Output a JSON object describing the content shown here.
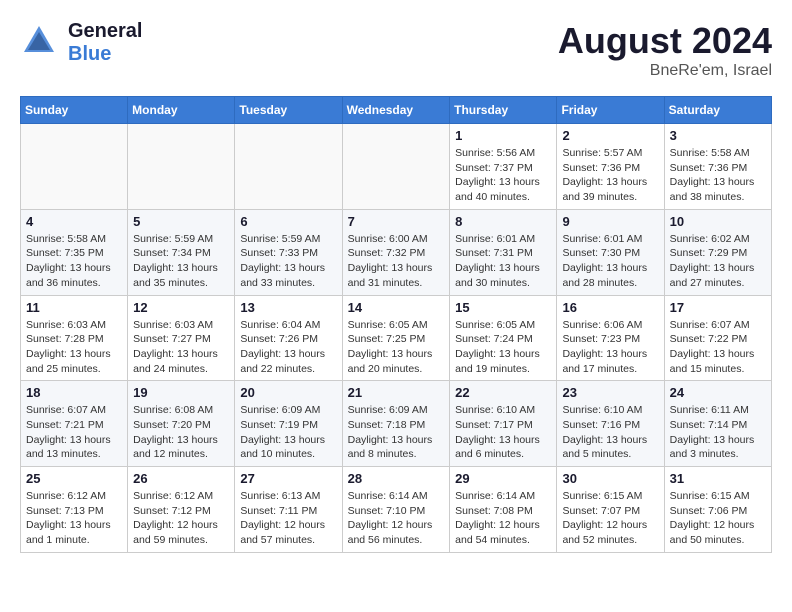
{
  "header": {
    "logo": {
      "general": "General",
      "blue": "Blue"
    },
    "month_year": "August 2024",
    "location": "BneRe'em, Israel"
  },
  "weekdays": [
    "Sunday",
    "Monday",
    "Tuesday",
    "Wednesday",
    "Thursday",
    "Friday",
    "Saturday"
  ],
  "weeks": [
    [
      {
        "day": "",
        "info": ""
      },
      {
        "day": "",
        "info": ""
      },
      {
        "day": "",
        "info": ""
      },
      {
        "day": "",
        "info": ""
      },
      {
        "day": "1",
        "info": "Sunrise: 5:56 AM\nSunset: 7:37 PM\nDaylight: 13 hours\nand 40 minutes."
      },
      {
        "day": "2",
        "info": "Sunrise: 5:57 AM\nSunset: 7:36 PM\nDaylight: 13 hours\nand 39 minutes."
      },
      {
        "day": "3",
        "info": "Sunrise: 5:58 AM\nSunset: 7:36 PM\nDaylight: 13 hours\nand 38 minutes."
      }
    ],
    [
      {
        "day": "4",
        "info": "Sunrise: 5:58 AM\nSunset: 7:35 PM\nDaylight: 13 hours\nand 36 minutes."
      },
      {
        "day": "5",
        "info": "Sunrise: 5:59 AM\nSunset: 7:34 PM\nDaylight: 13 hours\nand 35 minutes."
      },
      {
        "day": "6",
        "info": "Sunrise: 5:59 AM\nSunset: 7:33 PM\nDaylight: 13 hours\nand 33 minutes."
      },
      {
        "day": "7",
        "info": "Sunrise: 6:00 AM\nSunset: 7:32 PM\nDaylight: 13 hours\nand 31 minutes."
      },
      {
        "day": "8",
        "info": "Sunrise: 6:01 AM\nSunset: 7:31 PM\nDaylight: 13 hours\nand 30 minutes."
      },
      {
        "day": "9",
        "info": "Sunrise: 6:01 AM\nSunset: 7:30 PM\nDaylight: 13 hours\nand 28 minutes."
      },
      {
        "day": "10",
        "info": "Sunrise: 6:02 AM\nSunset: 7:29 PM\nDaylight: 13 hours\nand 27 minutes."
      }
    ],
    [
      {
        "day": "11",
        "info": "Sunrise: 6:03 AM\nSunset: 7:28 PM\nDaylight: 13 hours\nand 25 minutes."
      },
      {
        "day": "12",
        "info": "Sunrise: 6:03 AM\nSunset: 7:27 PM\nDaylight: 13 hours\nand 24 minutes."
      },
      {
        "day": "13",
        "info": "Sunrise: 6:04 AM\nSunset: 7:26 PM\nDaylight: 13 hours\nand 22 minutes."
      },
      {
        "day": "14",
        "info": "Sunrise: 6:05 AM\nSunset: 7:25 PM\nDaylight: 13 hours\nand 20 minutes."
      },
      {
        "day": "15",
        "info": "Sunrise: 6:05 AM\nSunset: 7:24 PM\nDaylight: 13 hours\nand 19 minutes."
      },
      {
        "day": "16",
        "info": "Sunrise: 6:06 AM\nSunset: 7:23 PM\nDaylight: 13 hours\nand 17 minutes."
      },
      {
        "day": "17",
        "info": "Sunrise: 6:07 AM\nSunset: 7:22 PM\nDaylight: 13 hours\nand 15 minutes."
      }
    ],
    [
      {
        "day": "18",
        "info": "Sunrise: 6:07 AM\nSunset: 7:21 PM\nDaylight: 13 hours\nand 13 minutes."
      },
      {
        "day": "19",
        "info": "Sunrise: 6:08 AM\nSunset: 7:20 PM\nDaylight: 13 hours\nand 12 minutes."
      },
      {
        "day": "20",
        "info": "Sunrise: 6:09 AM\nSunset: 7:19 PM\nDaylight: 13 hours\nand 10 minutes."
      },
      {
        "day": "21",
        "info": "Sunrise: 6:09 AM\nSunset: 7:18 PM\nDaylight: 13 hours\nand 8 minutes."
      },
      {
        "day": "22",
        "info": "Sunrise: 6:10 AM\nSunset: 7:17 PM\nDaylight: 13 hours\nand 6 minutes."
      },
      {
        "day": "23",
        "info": "Sunrise: 6:10 AM\nSunset: 7:16 PM\nDaylight: 13 hours\nand 5 minutes."
      },
      {
        "day": "24",
        "info": "Sunrise: 6:11 AM\nSunset: 7:14 PM\nDaylight: 13 hours\nand 3 minutes."
      }
    ],
    [
      {
        "day": "25",
        "info": "Sunrise: 6:12 AM\nSunset: 7:13 PM\nDaylight: 13 hours\nand 1 minute."
      },
      {
        "day": "26",
        "info": "Sunrise: 6:12 AM\nSunset: 7:12 PM\nDaylight: 12 hours\nand 59 minutes."
      },
      {
        "day": "27",
        "info": "Sunrise: 6:13 AM\nSunset: 7:11 PM\nDaylight: 12 hours\nand 57 minutes."
      },
      {
        "day": "28",
        "info": "Sunrise: 6:14 AM\nSunset: 7:10 PM\nDaylight: 12 hours\nand 56 minutes."
      },
      {
        "day": "29",
        "info": "Sunrise: 6:14 AM\nSunset: 7:08 PM\nDaylight: 12 hours\nand 54 minutes."
      },
      {
        "day": "30",
        "info": "Sunrise: 6:15 AM\nSunset: 7:07 PM\nDaylight: 12 hours\nand 52 minutes."
      },
      {
        "day": "31",
        "info": "Sunrise: 6:15 AM\nSunset: 7:06 PM\nDaylight: 12 hours\nand 50 minutes."
      }
    ]
  ]
}
